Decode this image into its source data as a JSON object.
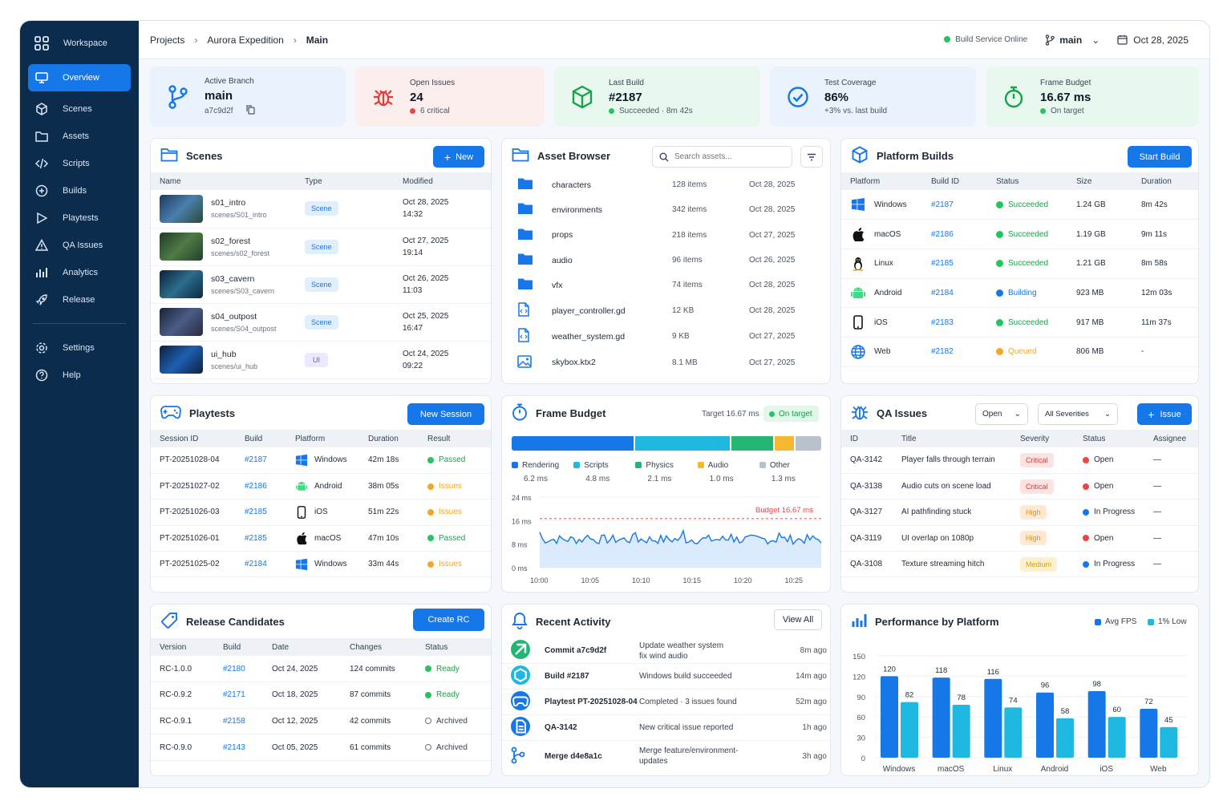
{
  "sidebar": {
    "workspace": "Workspace",
    "items": [
      {
        "label": "Overview"
      },
      {
        "label": "Scenes"
      },
      {
        "label": "Assets"
      },
      {
        "label": "Scripts"
      },
      {
        "label": "Builds"
      },
      {
        "label": "Playtests"
      },
      {
        "label": "QA Issues"
      },
      {
        "label": "Analytics"
      },
      {
        "label": "Release"
      }
    ],
    "bottom": [
      {
        "label": "Settings"
      },
      {
        "label": "Help"
      }
    ]
  },
  "breadcrumb": [
    "Projects",
    "Aurora Expedition",
    "Main"
  ],
  "topbar": {
    "service": "Build Service Online",
    "branch": "main",
    "date": "Oct 28, 2025"
  },
  "stats": {
    "branch": {
      "label": "Active Branch",
      "value": "main",
      "sub": "a7c9d2f"
    },
    "issues": {
      "label": "Open Issues",
      "value": "24",
      "sub": "6 critical"
    },
    "build": {
      "label": "Last Build",
      "value": "#2187",
      "sub": "Succeeded · 8m 42s"
    },
    "coverage": {
      "label": "Test Coverage",
      "value": "86%",
      "sub": "+3% vs. last build"
    },
    "frame": {
      "label": "Frame Budget",
      "value": "16.67 ms",
      "sub": "On target"
    }
  },
  "scenes": {
    "title": "Scenes",
    "new_label": "New",
    "columns": [
      "Name",
      "Type",
      "Modified"
    ],
    "rows": [
      {
        "name": "s01_intro",
        "path": "scenes/S01_intro",
        "type": "Scene",
        "date": "Oct 28, 2025",
        "time": "14:32"
      },
      {
        "name": "s02_forest",
        "path": "scenes/s02_forest",
        "type": "Scene",
        "date": "Oct 27, 2025",
        "time": "19:14"
      },
      {
        "name": "s03_cavern",
        "path": "scenes/S03_cavern",
        "type": "Scene",
        "date": "Oct 26, 2025",
        "time": "11:03"
      },
      {
        "name": "s04_outpost",
        "path": "scenes/S04_outpost",
        "type": "Scene",
        "date": "Oct 25, 2025",
        "time": "16:47"
      },
      {
        "name": "ui_hub",
        "path": "scenes/ui_hub",
        "type": "UI",
        "date": "Oct 24, 2025",
        "time": "09:22"
      }
    ]
  },
  "assets": {
    "title": "Asset Browser",
    "search_placeholder": "Search assets...",
    "rows": [
      {
        "name": "characters",
        "size": "128 items",
        "date": "Oct 28, 2025",
        "kind": "folder"
      },
      {
        "name": "environments",
        "size": "342 items",
        "date": "Oct 28, 2025",
        "kind": "folder"
      },
      {
        "name": "props",
        "size": "218 items",
        "date": "Oct 27, 2025",
        "kind": "folder"
      },
      {
        "name": "audio",
        "size": "96 items",
        "date": "Oct 26, 2025",
        "kind": "folder"
      },
      {
        "name": "vfx",
        "size": "74 items",
        "date": "Oct 28, 2025",
        "kind": "folder"
      },
      {
        "name": "player_controller.gd",
        "size": "12 KB",
        "date": "Oct 28, 2025",
        "kind": "file"
      },
      {
        "name": "weather_system.gd",
        "size": "9 KB",
        "date": "Oct 27, 2025",
        "kind": "file"
      },
      {
        "name": "skybox.ktx2",
        "size": "8.1 MB",
        "date": "Oct 27, 2025",
        "kind": "image"
      }
    ]
  },
  "builds": {
    "title": "Platform Builds",
    "start_label": "Start Build",
    "columns": [
      "Platform",
      "Build ID",
      "Status",
      "Size",
      "Duration"
    ],
    "rows": [
      {
        "platform": "Windows",
        "id": "#2187",
        "status": "Succeeded",
        "size": "1.24 GB",
        "duration": "8m 42s",
        "color": "#22c55e"
      },
      {
        "platform": "macOS",
        "id": "#2186",
        "status": "Succeeded",
        "size": "1.19 GB",
        "duration": "9m 11s",
        "color": "#22c55e"
      },
      {
        "platform": "Linux",
        "id": "#2185",
        "status": "Succeeded",
        "size": "1.21 GB",
        "duration": "8m 58s",
        "color": "#22c55e"
      },
      {
        "platform": "Android",
        "id": "#2184",
        "status": "Building",
        "size": "923 MB",
        "duration": "12m 03s",
        "color": "#1677e8"
      },
      {
        "platform": "iOS",
        "id": "#2183",
        "status": "Succeeded",
        "size": "917 MB",
        "duration": "11m 37s",
        "color": "#22c55e"
      },
      {
        "platform": "Web",
        "id": "#2182",
        "status": "Queued",
        "size": "806 MB",
        "duration": "-",
        "color": "#f5a623"
      }
    ]
  },
  "playtests": {
    "title": "Playtests",
    "new_label": "New Session",
    "columns": [
      "Session ID",
      "Build",
      "Platform",
      "Duration",
      "Result"
    ],
    "rows": [
      {
        "id": "PT-20251028-04",
        "build": "#2187",
        "platform": "Windows",
        "duration": "42m 18s",
        "result": "Passed",
        "color": "#22c55e"
      },
      {
        "id": "PT-20251027-02",
        "build": "#2186",
        "platform": "Android",
        "duration": "38m 05s",
        "result": "Issues",
        "color": "#f5a623"
      },
      {
        "id": "PT-20251026-03",
        "build": "#2185",
        "platform": "iOS",
        "duration": "51m 22s",
        "result": "Issues",
        "color": "#f5a623"
      },
      {
        "id": "PT-20251026-01",
        "build": "#2185",
        "platform": "macOS",
        "duration": "47m 10s",
        "result": "Passed",
        "color": "#22c55e"
      },
      {
        "id": "PT-20251025-02",
        "build": "#2184",
        "platform": "Windows",
        "duration": "33m 44s",
        "result": "Issues",
        "color": "#f5a623"
      }
    ]
  },
  "frame": {
    "title": "Frame Budget",
    "target": "Target 16.67 ms",
    "badge": "On target",
    "budget_label": "Budget 16.67 ms",
    "segments": [
      {
        "name": "Rendering",
        "ms": "6.2 ms",
        "value": 6.2,
        "color": "#1677e8"
      },
      {
        "name": "Scripts",
        "ms": "4.8 ms",
        "value": 4.8,
        "color": "#1fb8e0"
      },
      {
        "name": "Physics",
        "ms": "2.1 ms",
        "value": 2.1,
        "color": "#22b573"
      },
      {
        "name": "Audio",
        "ms": "1.0 ms",
        "value": 1.0,
        "color": "#f5b82e"
      },
      {
        "name": "Other",
        "ms": "1.3 ms",
        "value": 1.3,
        "color": "#b8c1cc"
      }
    ],
    "yticks": [
      "24 ms",
      "16 ms",
      "8 ms",
      "0 ms"
    ],
    "xticks": [
      "10:00",
      "10:05",
      "10:10",
      "10:15",
      "10:20",
      "10:25"
    ]
  },
  "qa": {
    "title": "QA Issues",
    "filter_status": "Open",
    "filter_sev": "All Severities",
    "add_label": "Issue",
    "columns": [
      "ID",
      "Title",
      "Severity",
      "Status",
      "Assignee"
    ],
    "rows": [
      {
        "id": "QA-3142",
        "title": "Player falls through terrain",
        "sev": "Critical",
        "status": "Open",
        "assignee": "—",
        "scolor": "#ef4444",
        "sbg": "#fde2e2",
        "sfg": "#e53935"
      },
      {
        "id": "QA-3138",
        "title": "Audio cuts on scene load",
        "sev": "Critical",
        "status": "Open",
        "assignee": "—",
        "scolor": "#ef4444",
        "sbg": "#fde2e2",
        "sfg": "#e53935"
      },
      {
        "id": "QA-3127",
        "title": "AI pathfinding stuck",
        "sev": "High",
        "status": "In Progress",
        "assignee": "—",
        "scolor": "#1677e8",
        "sbg": "#fde9d4",
        "sfg": "#f08a1c"
      },
      {
        "id": "QA-3119",
        "title": "UI overlap on 1080p",
        "sev": "High",
        "status": "Open",
        "assignee": "—",
        "scolor": "#ef4444",
        "sbg": "#fde9d4",
        "sfg": "#f08a1c"
      },
      {
        "id": "QA-3108",
        "title": "Texture streaming hitch",
        "sev": "Medium",
        "status": "In Progress",
        "assignee": "—",
        "scolor": "#1677e8",
        "sbg": "#fdf0cf",
        "sfg": "#d4a20a"
      }
    ]
  },
  "releases": {
    "title": "Release Candidates",
    "create_label": "Create RC",
    "columns": [
      "Version",
      "Build",
      "Date",
      "Changes",
      "Status"
    ],
    "rows": [
      {
        "version": "RC-1.0.0",
        "build": "#2180",
        "date": "Oct 24, 2025",
        "changes": "124 commits",
        "status": "Ready",
        "ready": true
      },
      {
        "version": "RC-0.9.2",
        "build": "#2171",
        "date": "Oct 18, 2025",
        "changes": "87 commits",
        "status": "Ready",
        "ready": true
      },
      {
        "version": "RC-0.9.1",
        "build": "#2158",
        "date": "Oct 12, 2025",
        "changes": "42 commits",
        "status": "Archived",
        "ready": false
      },
      {
        "version": "RC-0.9.0",
        "build": "#2143",
        "date": "Oct 05, 2025",
        "changes": "61 commits",
        "status": "Archived",
        "ready": false
      }
    ]
  },
  "activity": {
    "title": "Recent Activity",
    "view_all": "View All",
    "rows": [
      {
        "subject": "Commit a7c9d2f",
        "desc1": "Update weather system",
        "desc2": "fix wind audio",
        "time": "8m ago",
        "icon": "commit-icon",
        "color": "#22b573"
      },
      {
        "subject": "Build #2187",
        "desc1": "Windows build succeeded",
        "desc2": "",
        "time": "14m ago",
        "icon": "build-icon",
        "color": "#1fb8e0"
      },
      {
        "subject": "Playtest PT-20251028-04",
        "desc1": "Completed · 3 issues found",
        "desc2": "",
        "time": "52m ago",
        "icon": "gamepad-icon",
        "color": "#1677e8"
      },
      {
        "subject": "QA-3142",
        "desc1": "New critical issue reported",
        "desc2": "",
        "time": "1h ago",
        "icon": "document-icon",
        "color": "#1677e8"
      },
      {
        "subject": "Merge d4e8a1c",
        "desc1": "Merge feature/environment-",
        "desc2": "updates",
        "time": "3h ago",
        "icon": "merge-icon",
        "color": "#1677e8"
      }
    ]
  },
  "perf": {
    "title": "Performance by Platform",
    "legend": [
      "Avg FPS",
      "1% Low"
    ],
    "colors": [
      "#1677e8",
      "#1fb8e0"
    ],
    "yticks": [
      "150",
      "120",
      "90",
      "60",
      "30",
      "0"
    ]
  },
  "chart_data": {
    "type": "bar",
    "title": "Performance by Platform",
    "categories": [
      "Windows",
      "macOS",
      "Linux",
      "Android",
      "iOS",
      "Web"
    ],
    "ylim": [
      0,
      150
    ],
    "series": [
      {
        "name": "Avg FPS",
        "values": [
          120,
          118,
          116,
          96,
          98,
          72
        ]
      },
      {
        "name": "1% Low",
        "values": [
          82,
          78,
          74,
          58,
          60,
          45
        ]
      }
    ]
  }
}
